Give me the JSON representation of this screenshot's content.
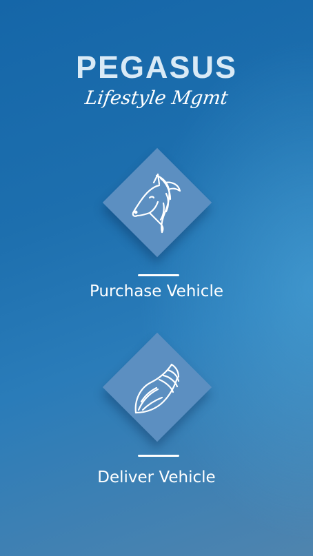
{
  "brand": {
    "title": "PEGASUS",
    "subtitle": "Lifestyle Mgmt"
  },
  "options": [
    {
      "label": "Purchase Vehicle",
      "icon": "horse-head-icon"
    },
    {
      "label": "Deliver Vehicle",
      "icon": "wing-icon"
    }
  ],
  "colors": {
    "background_top": "#1566a8",
    "background_bottom": "#4f84ae",
    "diamond": "#5c8fc1",
    "title": "#d9eaf6",
    "text": "#ffffff"
  }
}
